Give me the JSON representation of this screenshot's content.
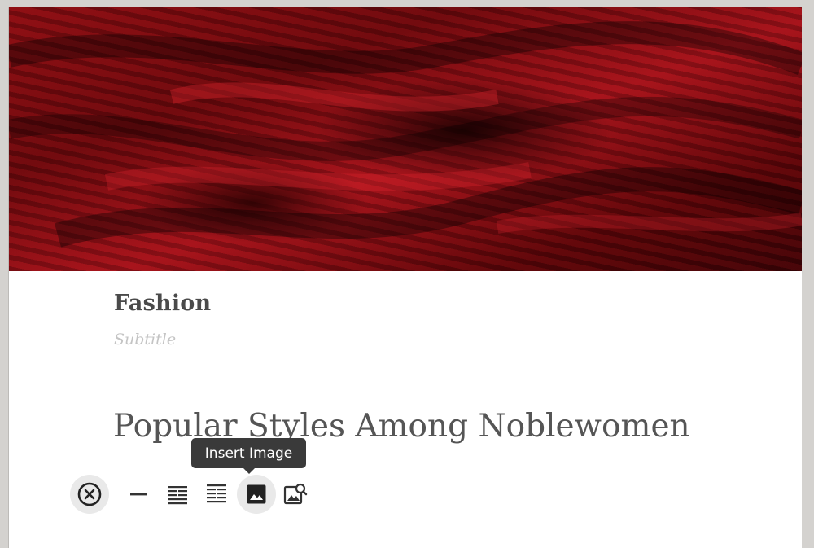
{
  "post": {
    "category": "Fashion",
    "subtitle_placeholder": "Subtitle",
    "headline": "Popular Styles Among Noblewomen"
  },
  "toolbar": {
    "tooltip": "Insert Image",
    "buttons": [
      {
        "name": "close-icon",
        "label": "Close"
      },
      {
        "name": "divider-icon",
        "label": "Insert divider"
      },
      {
        "name": "text-wrap-icon",
        "label": "Insert text block"
      },
      {
        "name": "list-block-icon",
        "label": "Insert list block"
      },
      {
        "name": "image-icon",
        "label": "Insert Image"
      },
      {
        "name": "image-search-icon",
        "label": "Search images"
      }
    ]
  },
  "colors": {
    "cover_red": "#8a0d12",
    "text_dark": "#4a4a4a",
    "subtitle_gray": "#c4c4c4",
    "tooltip_bg": "#3a3a3a"
  }
}
